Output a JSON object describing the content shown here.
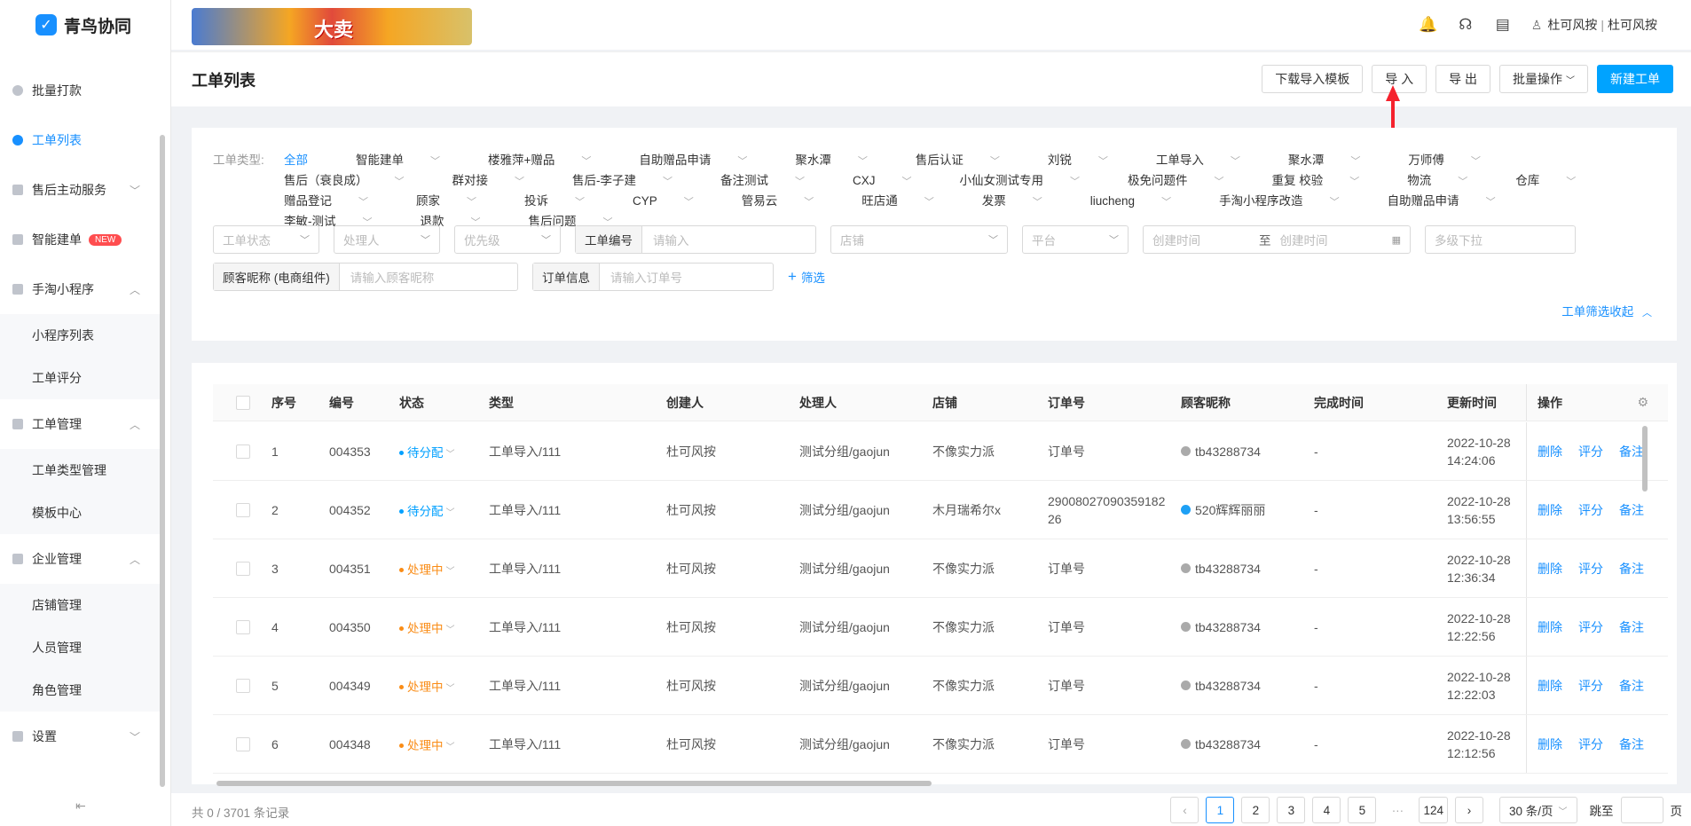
{
  "app": {
    "logo_text": "青鸟协同",
    "logo_mark": "✓"
  },
  "banner": {
    "text": "大卖"
  },
  "header": {
    "user_name": "杜可风按",
    "user_org": "杜可风按",
    "sep": "|"
  },
  "sidebar": {
    "items": [
      {
        "label": "批量打款"
      },
      {
        "label": "工单列表"
      },
      {
        "label": "售后主动服务"
      },
      {
        "label": "智能建单",
        "badge": "NEW"
      },
      {
        "label": "手淘小程序",
        "children": [
          "小程序列表",
          "工单评分"
        ]
      },
      {
        "label": "工单管理",
        "children": [
          "工单类型管理",
          "模板中心"
        ]
      },
      {
        "label": "企业管理",
        "children": [
          "店铺管理",
          "人员管理",
          "角色管理"
        ]
      },
      {
        "label": "设置"
      }
    ]
  },
  "page": {
    "title": "工单列表"
  },
  "toolbar": {
    "download_template": "下载导入模板",
    "import": "导 入",
    "export": "导 出",
    "batch_ops": "批量操作",
    "new_ticket": "新建工单"
  },
  "filters": {
    "type_label": "工单类型:",
    "types": [
      "全部",
      "智能建单",
      "楼雅萍+赠品",
      "自助赠品申请",
      "聚水潭",
      "售后认证",
      "刘锐",
      "工单导入",
      "聚水潭",
      "万师傅",
      "售后（衰良成）",
      "群对接",
      "售后-李子建",
      "备注测试",
      "CXJ",
      "小仙女测试专用",
      "极免问题件",
      "重复 校验",
      "物流",
      "仓库",
      "赠品登记",
      "顾家",
      "投诉",
      "CYP",
      "管易云",
      "旺店通",
      "发票",
      "liucheng",
      "手淘小程序改造",
      "自助赠品申请",
      "李敏-测试",
      "退款",
      "售后问题"
    ],
    "status_ph": "工单状态",
    "handler_ph": "处理人",
    "priority_ph": "优先级",
    "ticket_no_label": "工单编号",
    "ticket_no_ph": "请输入",
    "shop_ph": "店铺",
    "platform_ph": "平台",
    "created_start_ph": "创建时间",
    "range_sep": "至",
    "created_end_ph": "创建时间",
    "multi_ph": "多级下拉",
    "nick_label": "顾客昵称 (电商组件)",
    "nick_ph": "请输入顾客昵称",
    "order_label": "订单信息",
    "order_ph": "请输入订单号",
    "more_filter": "筛选",
    "collapse": "工单筛选收起"
  },
  "table": {
    "headers": {
      "seq": "序号",
      "no": "编号",
      "status": "状态",
      "type": "类型",
      "creator": "创建人",
      "handler": "处理人",
      "shop": "店铺",
      "order": "订单号",
      "customer": "顾客昵称",
      "done_time": "完成时间",
      "updated": "更新时间",
      "ops": "操作"
    },
    "rows": [
      {
        "seq": "1",
        "no": "004353",
        "status": "待分配",
        "type": "工单导入/111",
        "creator": "杜可风按",
        "handler": "测试分组/gaojun",
        "shop": "不像实力派",
        "order": "订单号",
        "customer": "tb43288734",
        "done": "-",
        "date": "2022-10-28",
        "time": "14:24:06"
      },
      {
        "seq": "2",
        "no": "004352",
        "status": "待分配",
        "type": "工单导入/111",
        "creator": "杜可风按",
        "handler": "测试分组/gaojun",
        "shop": "木月瑞希尔x",
        "order": "2900802709035918226",
        "customer": "520辉辉丽丽",
        "done": "-",
        "date": "2022-10-28",
        "time": "13:56:55"
      },
      {
        "seq": "3",
        "no": "004351",
        "status": "处理中",
        "type": "工单导入/111",
        "creator": "杜可风按",
        "handler": "测试分组/gaojun",
        "shop": "不像实力派",
        "order": "订单号",
        "customer": "tb43288734",
        "done": "-",
        "date": "2022-10-28",
        "time": "12:36:34"
      },
      {
        "seq": "4",
        "no": "004350",
        "status": "处理中",
        "type": "工单导入/111",
        "creator": "杜可风按",
        "handler": "测试分组/gaojun",
        "shop": "不像实力派",
        "order": "订单号",
        "customer": "tb43288734",
        "done": "-",
        "date": "2022-10-28",
        "time": "12:22:56"
      },
      {
        "seq": "5",
        "no": "004349",
        "status": "处理中",
        "type": "工单导入/111",
        "creator": "杜可风按",
        "handler": "测试分组/gaojun",
        "shop": "不像实力派",
        "order": "订单号",
        "customer": "tb43288734",
        "done": "-",
        "date": "2022-10-28",
        "time": "12:22:03"
      },
      {
        "seq": "6",
        "no": "004348",
        "status": "处理中",
        "type": "工单导入/111",
        "creator": "杜可风按",
        "handler": "测试分组/gaojun",
        "shop": "不像实力派",
        "order": "订单号",
        "customer": "tb43288734",
        "done": "-",
        "date": "2022-10-28",
        "time": "12:12:56"
      }
    ],
    "ops": {
      "delete": "删除",
      "rate": "评分",
      "note": "备注"
    }
  },
  "footer": {
    "total": "共 0 / 3701 条记录",
    "pages": [
      "1",
      "2",
      "3",
      "4",
      "5",
      "124"
    ],
    "dots": "···",
    "page_size": "30 条/页",
    "jump_label": "跳至",
    "page_unit": "页"
  },
  "colors": {
    "accent": "#1890ff",
    "primary_button": "#00a3ff",
    "pending": "#00a0ff",
    "processing": "#fa8c16"
  }
}
